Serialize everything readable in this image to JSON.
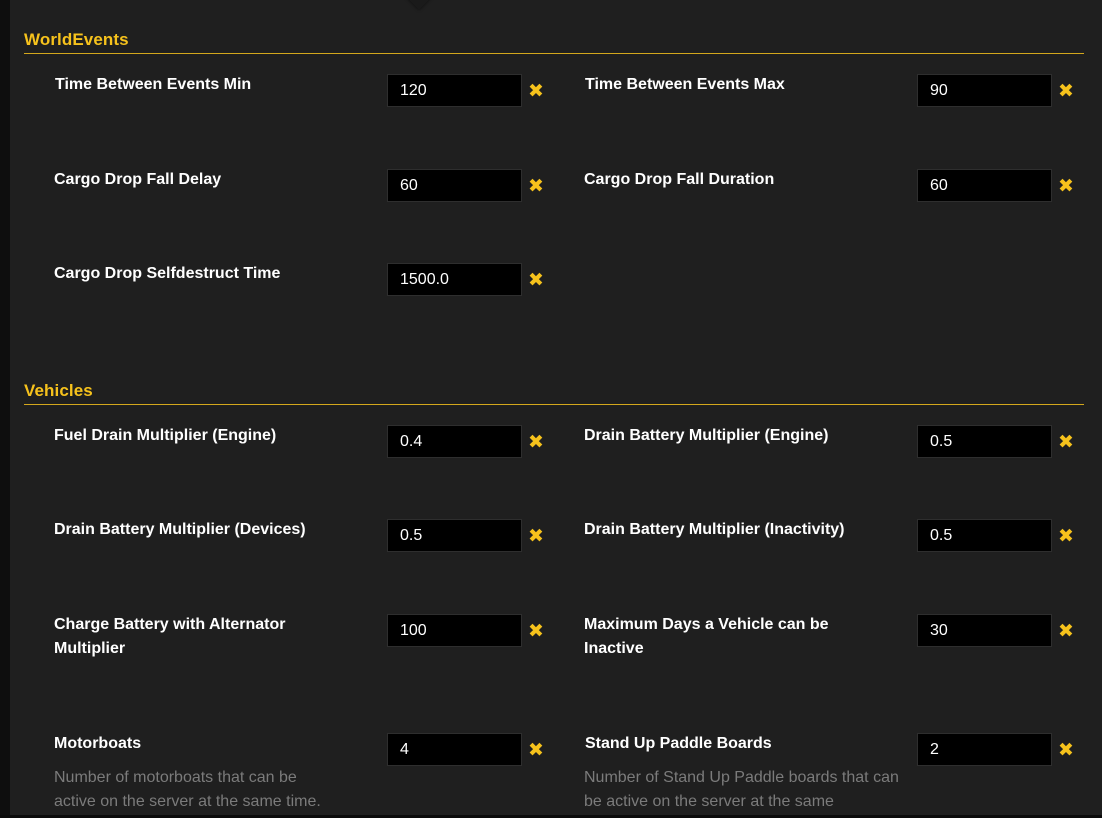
{
  "sections": {
    "world_events": {
      "title": "WorldEvents",
      "fields": [
        {
          "label": "Time Between Events Min",
          "value": "120"
        },
        {
          "label": "Time Between Events Max",
          "value": "90"
        },
        {
          "label": "Cargo Drop Fall Delay",
          "value": "60"
        },
        {
          "label": "Cargo Drop Fall Duration",
          "value": "60"
        },
        {
          "label": "Cargo Drop Selfdestruct Time",
          "value": "1500.0"
        }
      ]
    },
    "vehicles": {
      "title": "Vehicles",
      "fields": [
        {
          "label": "Fuel Drain Multiplier (Engine)",
          "value": "0.4"
        },
        {
          "label": "Drain Battery Multiplier (Engine)",
          "value": "0.5"
        },
        {
          "label": "Drain Battery Multiplier (Devices)",
          "value": "0.5"
        },
        {
          "label": "Drain Battery Multiplier (Inactivity)",
          "value": "0.5"
        },
        {
          "label": "Charge Battery with Alternator Multiplier",
          "value": "100"
        },
        {
          "label": "Maximum Days a Vehicle can be Inactive",
          "value": "30"
        },
        {
          "label": "Motorboats",
          "value": "4",
          "description": "Number of motorboats that can be active on the server at the same time."
        },
        {
          "label": "Stand Up Paddle Boards",
          "value": "2",
          "description": "Number of Stand Up Paddle boards that can be active on the server at the same"
        }
      ]
    }
  },
  "icons": {
    "clear": "close-icon",
    "clear_glyph": "✖"
  },
  "colors": {
    "accent": "#f6c21c",
    "panel_bg": "#1f1f1f",
    "input_bg": "#000000",
    "label": "#ffffff",
    "description": "#7b7b7b"
  }
}
